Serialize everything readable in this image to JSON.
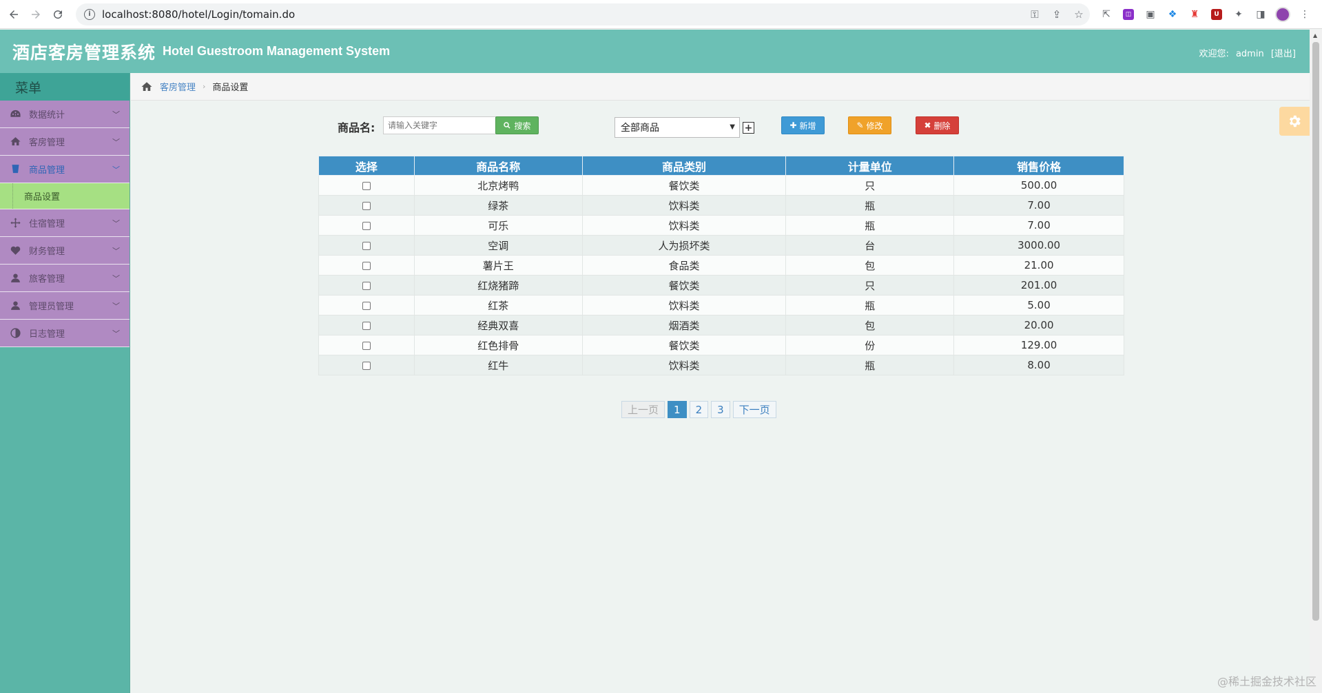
{
  "browser": {
    "url": "localhost:8080/hotel/Login/tomain.do"
  },
  "header": {
    "title_cn": "酒店客房管理系统",
    "title_en": "Hotel Guestroom Management System",
    "welcome_label": "欢迎您:",
    "username": "admin",
    "logout": "[退出]"
  },
  "sidebar": {
    "title": "菜单",
    "items": [
      {
        "label": "数据统计",
        "icon": "dashboard-icon"
      },
      {
        "label": "客房管理",
        "icon": "home-icon"
      },
      {
        "label": "商品管理",
        "icon": "cup-icon",
        "active": true
      },
      {
        "label": "住宿管理",
        "icon": "move-icon"
      },
      {
        "label": "财务管理",
        "icon": "heart-icon"
      },
      {
        "label": "旅客管理",
        "icon": "user-icon"
      },
      {
        "label": "管理员管理",
        "icon": "user-icon"
      },
      {
        "label": "日志管理",
        "icon": "contrast-icon"
      }
    ],
    "sub_item": "商品设置"
  },
  "breadcrumb": {
    "parent": "客房管理",
    "current": "商品设置"
  },
  "toolbar": {
    "search_label": "商品名:",
    "search_placeholder": "请输入关键字",
    "search_button": "搜索",
    "category_selected": "全部商品",
    "plus": "+",
    "add_button": "新增",
    "edit_button": "修改",
    "delete_button": "删除"
  },
  "table": {
    "headers": [
      "选择",
      "商品名称",
      "商品类别",
      "计量单位",
      "销售价格"
    ],
    "rows": [
      {
        "name": "北京烤鸭",
        "category": "餐饮类",
        "unit": "只",
        "price": "500.00"
      },
      {
        "name": "绿茶",
        "category": "饮料类",
        "unit": "瓶",
        "price": "7.00"
      },
      {
        "name": "可乐",
        "category": "饮料类",
        "unit": "瓶",
        "price": "7.00"
      },
      {
        "name": "空调",
        "category": "人为损坏类",
        "unit": "台",
        "price": "3000.00"
      },
      {
        "name": "薯片王",
        "category": "食品类",
        "unit": "包",
        "price": "21.00"
      },
      {
        "name": "红烧猪蹄",
        "category": "餐饮类",
        "unit": "只",
        "price": "201.00"
      },
      {
        "name": "红茶",
        "category": "饮料类",
        "unit": "瓶",
        "price": "5.00"
      },
      {
        "name": "经典双喜",
        "category": "烟酒类",
        "unit": "包",
        "price": "20.00"
      },
      {
        "name": "红色排骨",
        "category": "餐饮类",
        "unit": "份",
        "price": "129.00"
      },
      {
        "name": "红牛",
        "category": "饮料类",
        "unit": "瓶",
        "price": "8.00"
      }
    ]
  },
  "pagination": {
    "prev": "上一页",
    "pages": [
      "1",
      "2",
      "3"
    ],
    "next": "下一页"
  },
  "watermark": "@稀土掘金技术社区"
}
